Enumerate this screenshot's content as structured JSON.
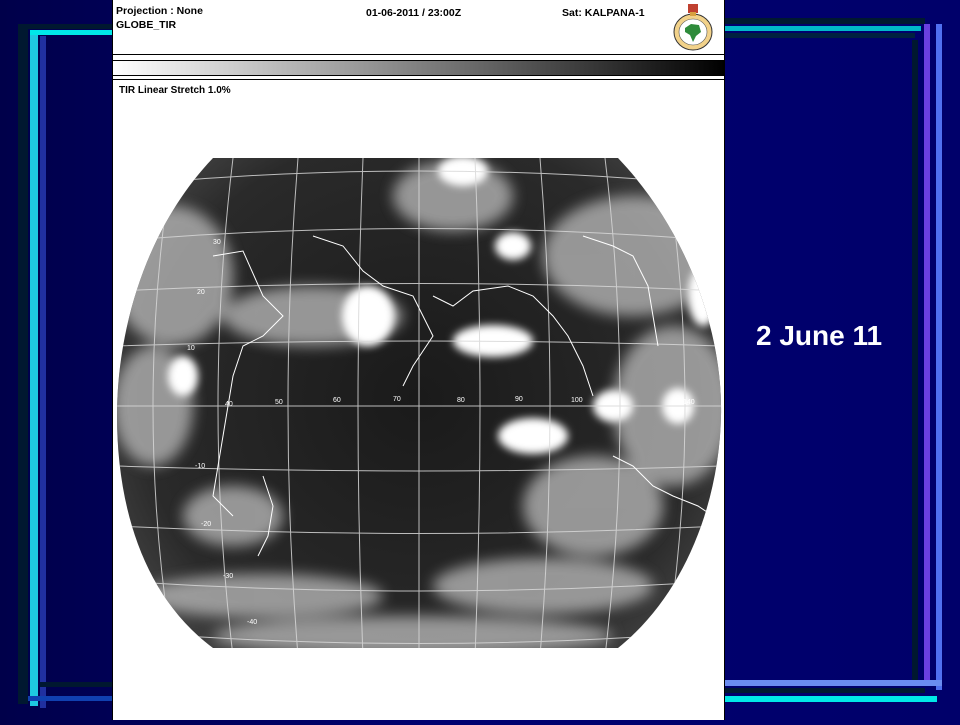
{
  "header": {
    "projection": "Projection : None",
    "product": "GLOBE_TIR",
    "datetime": "01-06-2011 / 23:00Z",
    "satellite": "Sat: KALPANA-1"
  },
  "stretch_label": "TIR Linear Stretch 1.0%",
  "slide_label": "2 June 11",
  "graticule": {
    "lon_labels": [
      "40",
      "50",
      "60",
      "70",
      "80",
      "90",
      "100",
      "140"
    ],
    "lat_labels": [
      "30",
      "20",
      "10",
      "-10",
      "-20",
      "-30",
      "-40"
    ]
  },
  "colors": {
    "background": "#00006a",
    "bar_light_blue": "#6a8cf0",
    "bar_cyan": "#00e8e8",
    "bar_dark": "#001830",
    "bar_violet": "#7a4cf0",
    "panel": "#ffffff"
  }
}
